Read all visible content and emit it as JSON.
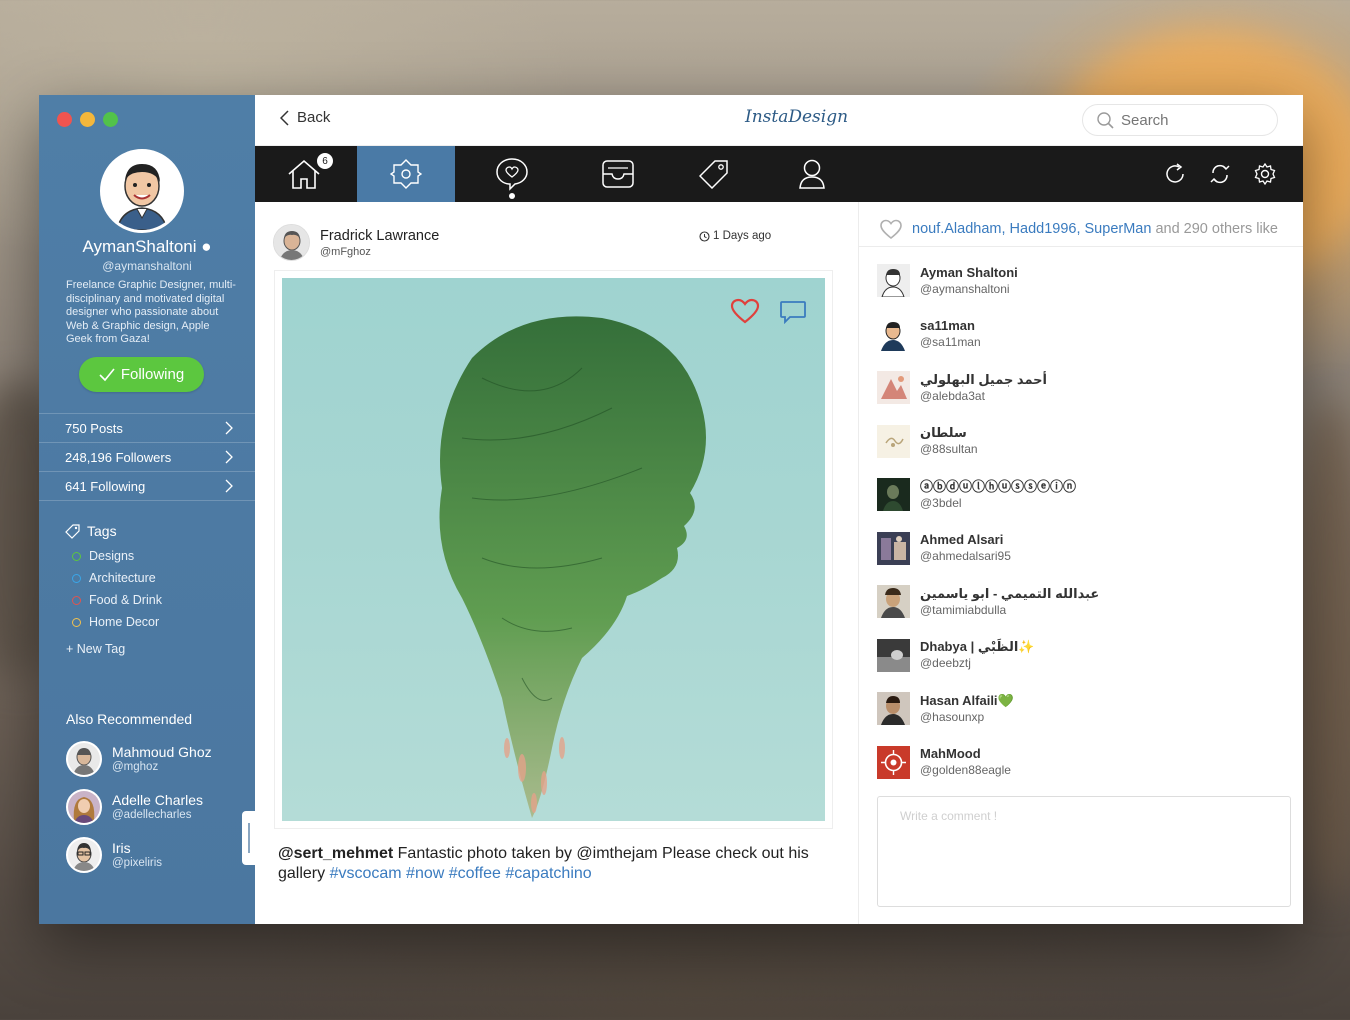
{
  "sidebar": {
    "profile": {
      "name": "AymanShaltoni",
      "handle": "@aymanshaltoni",
      "bio": "Freelance Graphic Designer, multi-disciplinary and motivated digital designer who passionate about Web & Graphic design, Apple Geek  from Gaza!"
    },
    "follow_label": "Following",
    "stats": [
      {
        "label": "750 Posts"
      },
      {
        "label": "248,196 Followers"
      },
      {
        "label": "641 Following"
      }
    ],
    "tags_title": "Tags",
    "tags": [
      {
        "label": "Designs",
        "color": "#5cc73f"
      },
      {
        "label": "Architecture",
        "color": "#3aa7e8"
      },
      {
        "label": "Food & Drink",
        "color": "#e2544d"
      },
      {
        "label": "Home Decor",
        "color": "#f2c14e"
      }
    ],
    "new_tag_label": "+ New Tag",
    "recommended_title": "Also Recommended",
    "recommended": [
      {
        "name": "Mahmoud Ghoz",
        "handle": "@mghoz"
      },
      {
        "name": "Adelle Charles",
        "handle": "@adellecharles"
      },
      {
        "name": "Iris",
        "handle": "@pixeliris"
      }
    ]
  },
  "topbar": {
    "back_label": "Back",
    "logo": "InstaDesign",
    "search_placeholder": "Search"
  },
  "nav": {
    "badge": "6",
    "items": [
      "home-icon",
      "explore-icon",
      "messages-icon",
      "inbox-icon",
      "tags-icon",
      "profile-icon"
    ],
    "right_items": [
      "refresh-icon",
      "sync-icon",
      "settings-icon"
    ]
  },
  "post": {
    "author_name": "Fradrick Lawrance",
    "author_handle": "@mFghoz",
    "time": "1 Days ago",
    "caption_mention": "@sert_mehmet",
    "caption_text": " Fantastic photo taken by @imthejam Please check out his gallery ",
    "hashtags": "#vscocam #now #coffee #capatchino"
  },
  "likes": {
    "names": "nouf.Aladham, Hadd1996, SuperMan",
    "others": " and 290 others like",
    "users": [
      {
        "name": "Ayman Shaltoni",
        "handle": "@aymanshaltoni"
      },
      {
        "name": "sa11man",
        "handle": "@sa11man"
      },
      {
        "name": "أحمد جميل البهلولي",
        "handle": "@alebda3at"
      },
      {
        "name": "سلطان",
        "handle": "@88sultan"
      },
      {
        "name": "ⓐⓑⓓⓤⓛⓗⓤⓢⓢⓔⓘⓝ",
        "handle": "@3bdel"
      },
      {
        "name": "Ahmed Alsari",
        "handle": "@ahmedalsari95"
      },
      {
        "name": "عبدالله التميمي - ابو ياسمين",
        "handle": "@tamimiabdulla"
      },
      {
        "name": "Dhabya | الظَبْي✨",
        "handle": "@deebztj"
      },
      {
        "name": "Hasan Alfaili💚",
        "handle": "@hasounxp"
      },
      {
        "name": "MahMood",
        "handle": "@golden88eagle"
      }
    ],
    "comment_placeholder": "Write a comment !"
  }
}
